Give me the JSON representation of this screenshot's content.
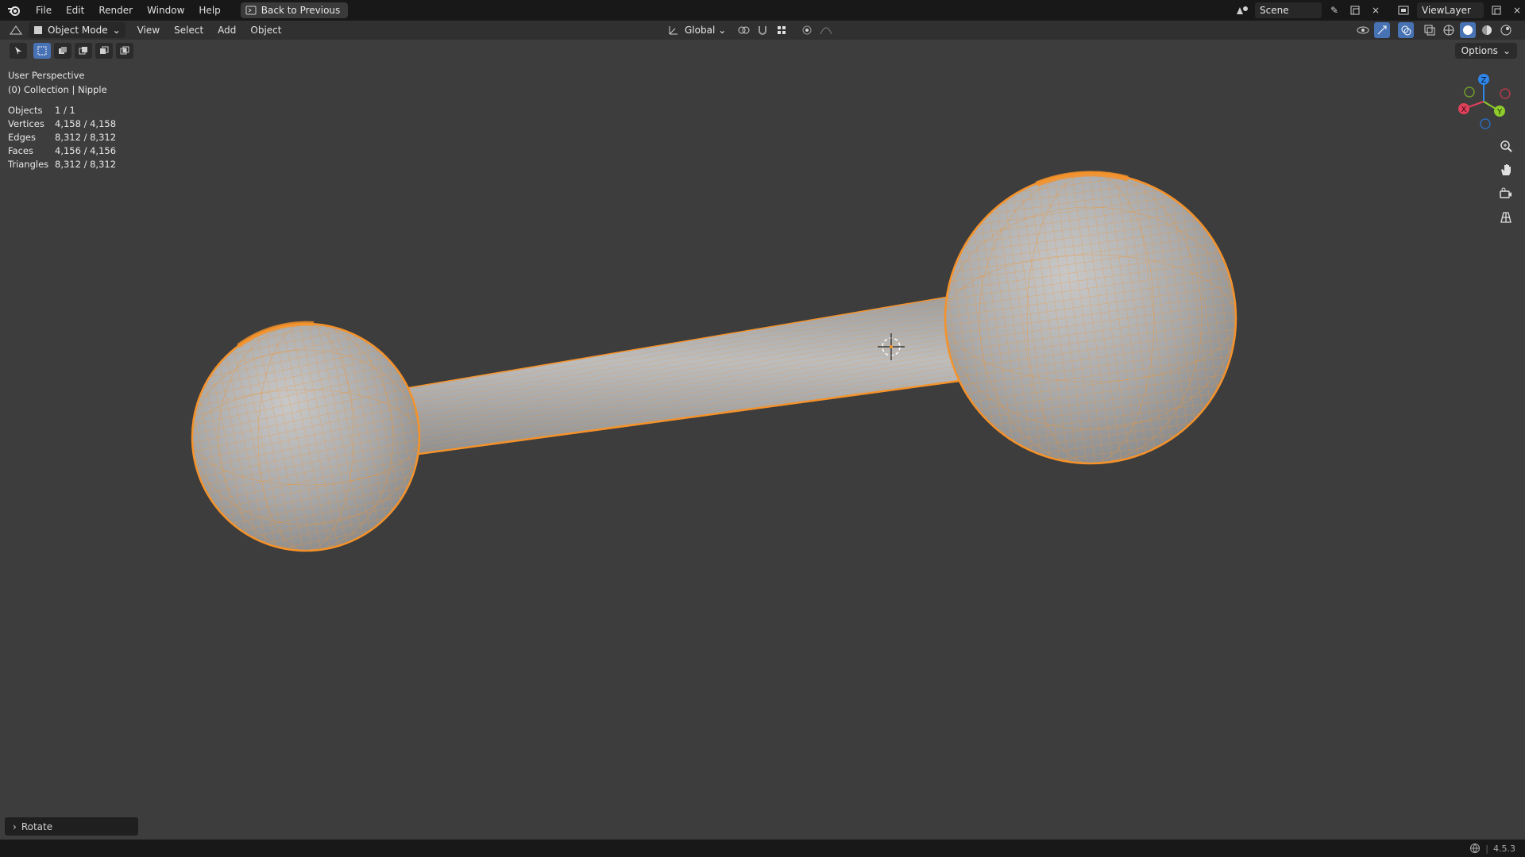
{
  "menubar": {
    "items": [
      "File",
      "Edit",
      "Render",
      "Window",
      "Help"
    ],
    "back_button": "Back to Previous",
    "scene_name": "Scene",
    "view_layer": "ViewLayer"
  },
  "header": {
    "mode": "Object Mode",
    "menus": [
      "View",
      "Select",
      "Add",
      "Object"
    ],
    "orientation": "Global"
  },
  "options_label": "Options",
  "viewport": {
    "perspective": "User Perspective",
    "collection": "(0) Collection | Nipple",
    "stats": [
      {
        "label": "Objects",
        "value": "1 / 1"
      },
      {
        "label": "Vertices",
        "value": "4,158 / 4,158"
      },
      {
        "label": "Edges",
        "value": "8,312 / 8,312"
      },
      {
        "label": "Faces",
        "value": "4,156 / 4,156"
      },
      {
        "label": "Triangles",
        "value": "8,312 / 8,312"
      }
    ]
  },
  "gizmo": {
    "x": "X",
    "y": "Y",
    "z": "Z"
  },
  "last_operator": "Rotate",
  "status": {
    "version": "4.5.3"
  },
  "colors": {
    "selection_orange": "#f5922a",
    "axis_x": "#e0405a",
    "axis_y": "#8dcc2a",
    "axis_z": "#2f86e8"
  }
}
